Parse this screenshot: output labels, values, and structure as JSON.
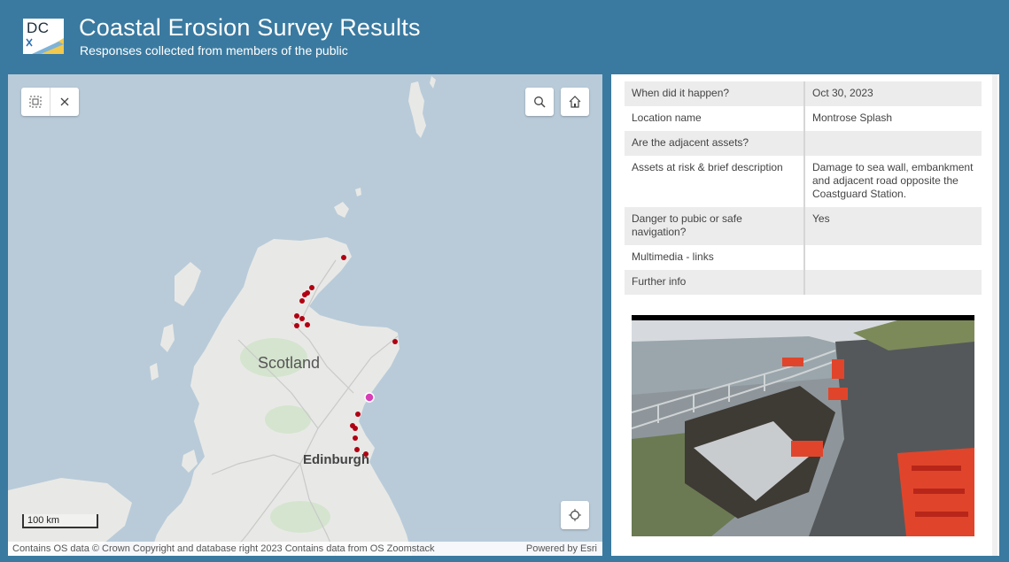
{
  "header": {
    "logo_text": "DC",
    "title": "Coastal Erosion Survey Results",
    "subtitle": "Responses collected from members of the public"
  },
  "map": {
    "labels": {
      "scotland": "Scotland",
      "edinburgh": "Edinburgh"
    },
    "scale_label": "100 km",
    "attribution_left": "Contains OS data © Crown Copyright and database right 2023 Contains data from OS Zoomstack",
    "attribution_right": "Powered by Esri",
    "controls": [
      "select-icon",
      "close-icon",
      "search-icon",
      "home-icon",
      "locate-icon"
    ],
    "point_color": "#b00012",
    "selected_point_color": "#d63fb5"
  },
  "attributes": [
    {
      "key": "When did it happen?",
      "value": "Oct 30, 2023"
    },
    {
      "key": "Location name",
      "value": "Montrose Splash"
    },
    {
      "key": "Are the adjacent assets?",
      "value": ""
    },
    {
      "key": "Assets at risk & brief description",
      "value": "Damage to sea wall, embankment and adjacent road opposite the Coastguard Station."
    },
    {
      "key": "Danger to pubic or safe navigation?",
      "value": "Yes"
    },
    {
      "key": "Multimedia - links",
      "value": ""
    },
    {
      "key": "Further info",
      "value": ""
    }
  ]
}
